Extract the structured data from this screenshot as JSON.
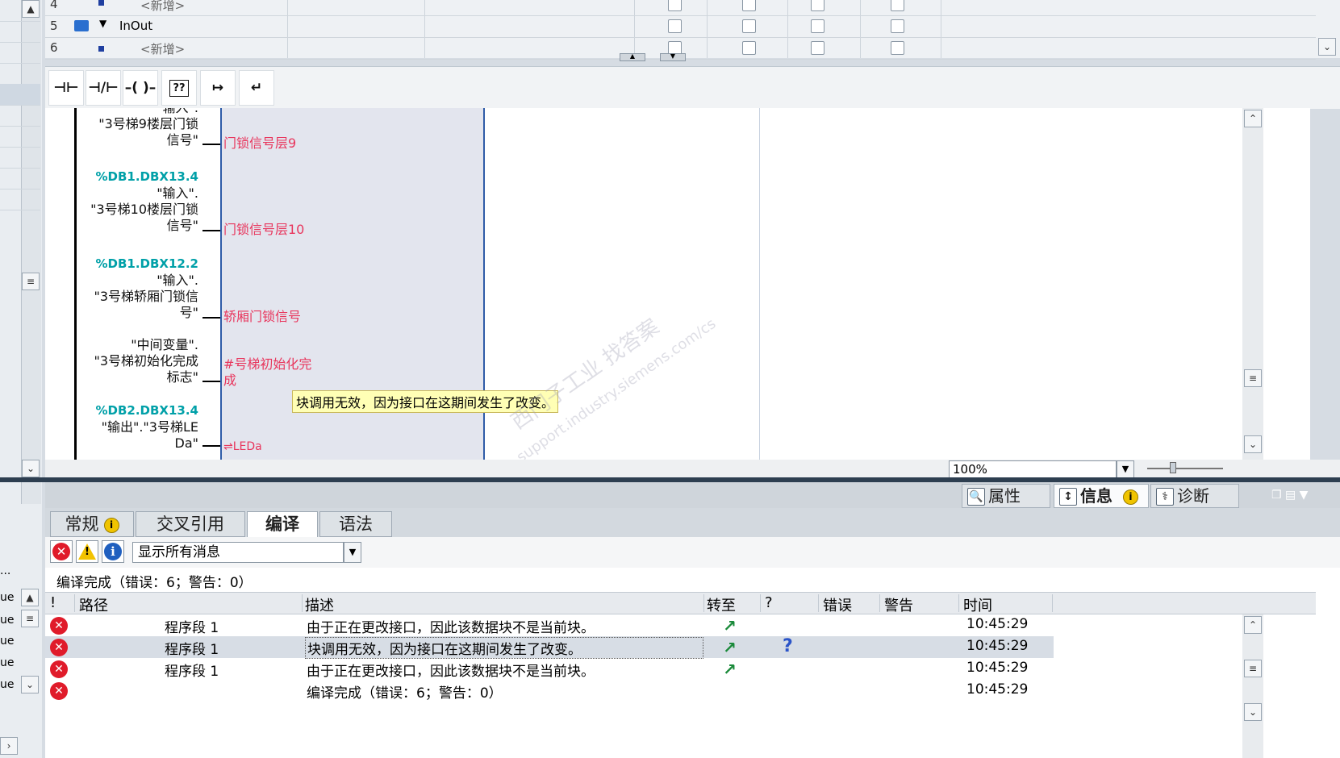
{
  "left_panel": {
    "ue_rows": [
      "ue",
      "ue",
      "ue",
      "ue",
      "ue"
    ],
    "ellipsis": "..."
  },
  "interface_table": {
    "rows": [
      {
        "num": "4",
        "name": "<新增>",
        "placeholder": true
      },
      {
        "num": "5",
        "name": "InOut",
        "placeholder": false
      },
      {
        "num": "6",
        "name": "<新增>",
        "placeholder": true
      }
    ]
  },
  "ladder_toolbar": {
    "buttons": [
      {
        "glyph": "⊣⊢",
        "icon": "contact-no-icon"
      },
      {
        "glyph": "⊣/⊢",
        "icon": "contact-nc-icon"
      },
      {
        "glyph": "–( )–",
        "icon": "coil-icon"
      },
      {
        "glyph": "??",
        "icon": "empty-box-icon"
      },
      {
        "glyph": "↦",
        "icon": "open-branch-icon"
      },
      {
        "glyph": "↵",
        "icon": "close-branch-icon"
      }
    ]
  },
  "editor": {
    "params": [
      {
        "addr": "",
        "tag_lines": [
          "\"输入\".",
          "\"3号梯9楼层门锁",
          "信号\""
        ],
        "pin": "门锁信号层9"
      },
      {
        "addr": "%DB1.DBX13.4",
        "tag_lines": [
          "\"输入\".",
          "\"3号梯10楼层门锁",
          "信号\""
        ],
        "pin": "门锁信号层10"
      },
      {
        "addr": "%DB1.DBX12.2",
        "tag_lines": [
          "\"输入\".",
          "\"3号梯轿厢门锁信",
          "号\""
        ],
        "pin": "轿厢门锁信号"
      },
      {
        "addr": "",
        "tag_lines": [
          "\"中间变量\".",
          "\"3号梯初始化完成",
          "标志\""
        ],
        "pin_lines": [
          "#号梯初始化完",
          "成"
        ]
      },
      {
        "addr": "%DB2.DBX13.4",
        "tag_lines": [
          "\"输出\".\"3号梯LE",
          "Da\""
        ],
        "pin": "⇌LEDa"
      }
    ],
    "tooltip": "块调用无效，因为接口在这期间发生了改变。",
    "watermark": [
      "西门子工业 找答案",
      "support.industry.siemens.com/cs"
    ]
  },
  "zoom": {
    "value": "100%"
  },
  "inspector": {
    "tabs": [
      {
        "label": "属性",
        "icon": "properties-icon",
        "active": false
      },
      {
        "label": "信息",
        "icon": "info-tab-icon",
        "active": true
      },
      {
        "label": "诊断",
        "icon": "diagnostics-icon",
        "active": false
      }
    ],
    "info_badge": "i",
    "sub_tabs": [
      {
        "label": "常规",
        "badge": "i"
      },
      {
        "label": "交叉引用"
      },
      {
        "label": "编译",
        "active": true
      },
      {
        "label": "语法"
      }
    ],
    "filter_select": "显示所有消息",
    "summary": "编译完成（错误：6；警告：0）",
    "columns": {
      "bang": "!",
      "path": "路径",
      "desc": "描述",
      "goto": "转至",
      "q": "?",
      "errors": "错误",
      "warnings": "警告",
      "time": "时间"
    },
    "rows": [
      {
        "path": "程序段 1",
        "desc": "由于正在更改接口，因此该数据块不是当前块。",
        "goto": true,
        "help": false,
        "time": "10:45:29",
        "selected": false
      },
      {
        "path": "程序段 1",
        "desc": "块调用无效，因为接口在这期间发生了改变。",
        "goto": true,
        "help": true,
        "time": "10:45:29",
        "selected": true
      },
      {
        "path": "程序段 1",
        "desc": "由于正在更改接口，因此该数据块不是当前块。",
        "goto": true,
        "help": false,
        "time": "10:45:29",
        "selected": false
      },
      {
        "path": "",
        "desc": "编译完成（错误：6；警告：0）",
        "goto": false,
        "help": false,
        "time": "10:45:29",
        "selected": false
      }
    ],
    "colors": {
      "error": "#e01b2a",
      "goto": "#1a8a3a",
      "pin": "#e8365d",
      "address": "#00a0a8"
    }
  }
}
